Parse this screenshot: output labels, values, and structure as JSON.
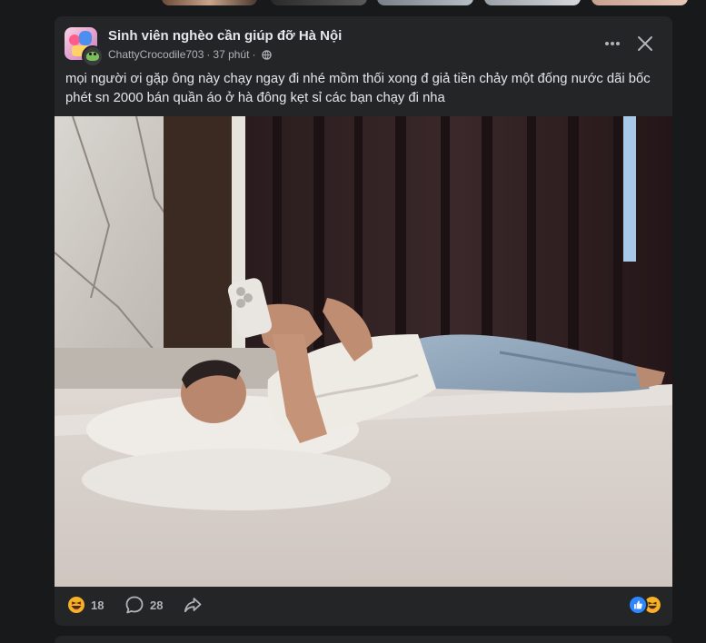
{
  "post": {
    "group_name": "Sinh viên nghèo cần giúp đỡ Hà Nội",
    "author": "ChattyCrocodile703",
    "separator": "·",
    "time": "37 phút",
    "privacy_icon": "globe-icon",
    "text": "mọi người ơi gặp ông này chạy ngay đi nhé mồm thối xong đ giả tiền chảy một đống nước dãi bốc phét sn 2000 bán quần áo ở hà đông kẹt sỉ các bạn chạy đi nha",
    "photo_description_icon": "photo",
    "actions": {
      "more_icon": "more-horizontal-icon",
      "close_icon": "close-icon"
    }
  },
  "footer": {
    "reaction_icon": "haha-emoji-icon",
    "reaction_count": "18",
    "comment_icon": "comment-bubble-icon",
    "comment_count": "28",
    "share_icon": "share-arrow-icon",
    "summary_reactions": [
      "like-icon",
      "haha-icon"
    ]
  },
  "colors": {
    "background": "#18191a",
    "card": "#242526",
    "text_primary": "#e4e6eb",
    "text_secondary": "#b0b3b8",
    "like_blue": "#2d88ff",
    "emoji_yellow": "#f7b125"
  }
}
